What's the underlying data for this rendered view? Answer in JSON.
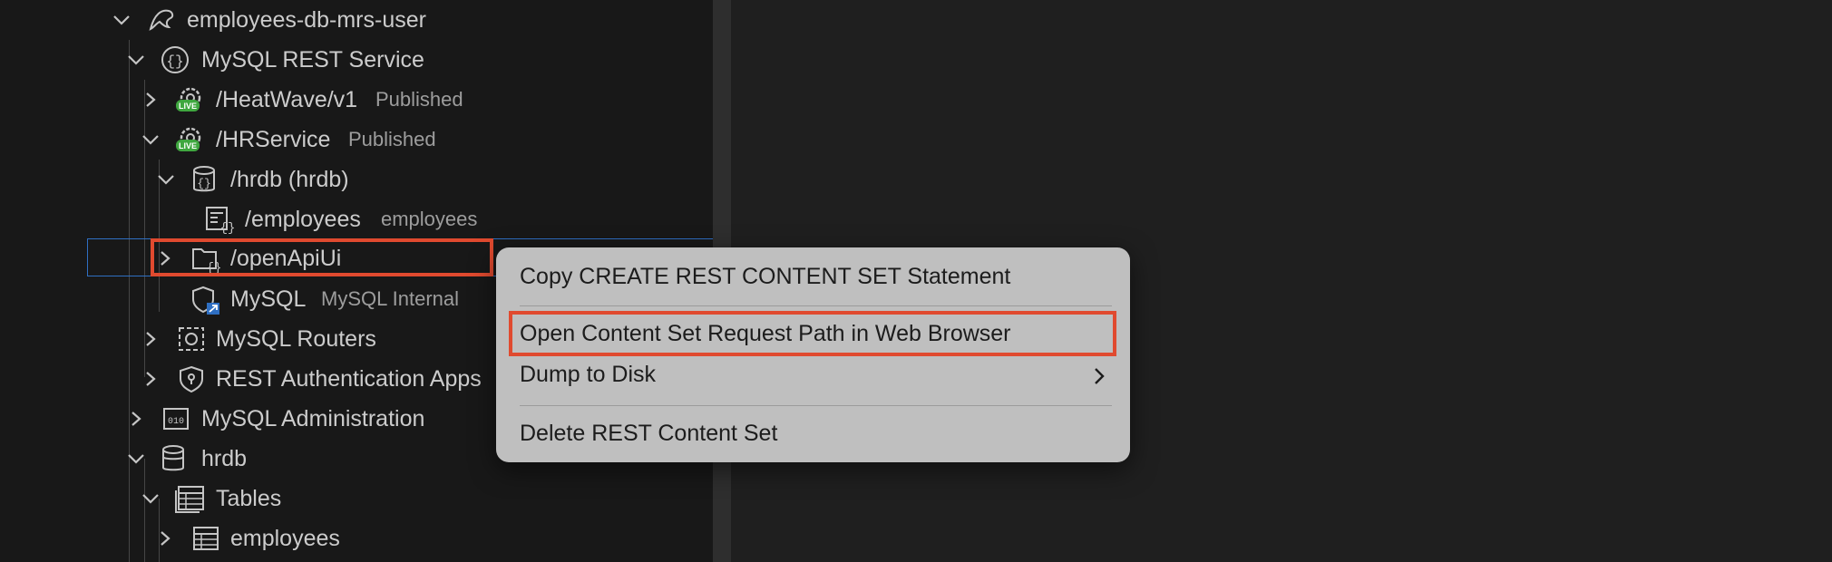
{
  "tree": {
    "items": [
      {
        "label": "employees-db-mrs-user",
        "desc": "",
        "icon": "mysql-dolphin-icon"
      },
      {
        "label": "MySQL REST Service",
        "desc": "",
        "icon": "rest-service-icon"
      },
      {
        "label": "/HeatWave/v1",
        "desc": "Published",
        "icon": "live-gear-icon"
      },
      {
        "label": "/HRService",
        "desc": "Published",
        "icon": "live-gear-icon"
      },
      {
        "label": "/hrdb (hrdb)",
        "desc": "",
        "icon": "db-schema-icon"
      },
      {
        "label": "/employees",
        "desc": "employees",
        "icon": "rest-object-icon"
      },
      {
        "label": "/openApiUi",
        "desc": "",
        "icon": "content-set-folder-icon"
      },
      {
        "label": "MySQL",
        "desc": "MySQL Internal",
        "icon": "auth-app-shield-icon"
      },
      {
        "label": "MySQL Routers",
        "desc": "",
        "icon": "router-icon"
      },
      {
        "label": "REST Authentication Apps",
        "desc": "",
        "icon": "shield-icon"
      },
      {
        "label": "MySQL Administration",
        "desc": "",
        "icon": "admin-icon"
      },
      {
        "label": "hrdb",
        "desc": "",
        "icon": "database-icon"
      },
      {
        "label": "Tables",
        "desc": "",
        "icon": "tables-icon"
      },
      {
        "label": "employees",
        "desc": "",
        "icon": "table-icon"
      }
    ]
  },
  "context_menu": {
    "items": [
      "Copy CREATE REST CONTENT SET Statement",
      "Open Content Set Request Path in Web Browser",
      "Dump to Disk",
      "Delete REST Content Set"
    ]
  },
  "colors": {
    "sidebar_bg": "#181818",
    "editor_bg": "#1f1f1f",
    "menu_bg": "#bfbfbf",
    "highlight": "#e04a2f",
    "selection": "#2f6fc2",
    "live_badge": "#3fa73f"
  }
}
